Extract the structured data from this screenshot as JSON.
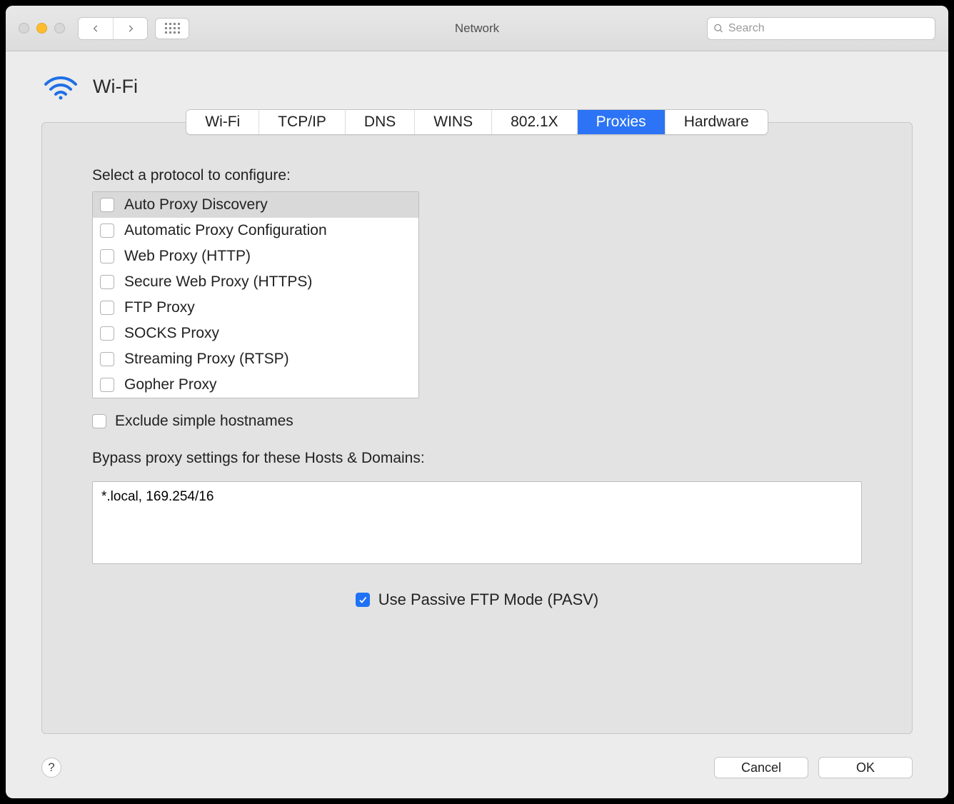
{
  "window": {
    "title": "Network"
  },
  "toolbar": {
    "search_placeholder": "Search"
  },
  "header": {
    "pane_title": "Wi-Fi"
  },
  "tabs": [
    {
      "label": "Wi-Fi",
      "active": false
    },
    {
      "label": "TCP/IP",
      "active": false
    },
    {
      "label": "DNS",
      "active": false
    },
    {
      "label": "WINS",
      "active": false
    },
    {
      "label": "802.1X",
      "active": false
    },
    {
      "label": "Proxies",
      "active": true
    },
    {
      "label": "Hardware",
      "active": false
    }
  ],
  "proxies": {
    "section_label": "Select a protocol to configure:",
    "protocols": [
      {
        "label": "Auto Proxy Discovery",
        "checked": false,
        "selected": true
      },
      {
        "label": "Automatic Proxy Configuration",
        "checked": false,
        "selected": false
      },
      {
        "label": "Web Proxy (HTTP)",
        "checked": false,
        "selected": false
      },
      {
        "label": "Secure Web Proxy (HTTPS)",
        "checked": false,
        "selected": false
      },
      {
        "label": "FTP Proxy",
        "checked": false,
        "selected": false
      },
      {
        "label": "SOCKS Proxy",
        "checked": false,
        "selected": false
      },
      {
        "label": "Streaming Proxy (RTSP)",
        "checked": false,
        "selected": false
      },
      {
        "label": "Gopher Proxy",
        "checked": false,
        "selected": false
      }
    ],
    "exclude_simple_label": "Exclude simple hostnames",
    "exclude_simple_checked": false,
    "bypass_label": "Bypass proxy settings for these Hosts & Domains:",
    "bypass_value": "*.local, 169.254/16",
    "pasv_label": "Use Passive FTP Mode (PASV)",
    "pasv_checked": true
  },
  "footer": {
    "help": "?",
    "cancel": "Cancel",
    "ok": "OK"
  }
}
